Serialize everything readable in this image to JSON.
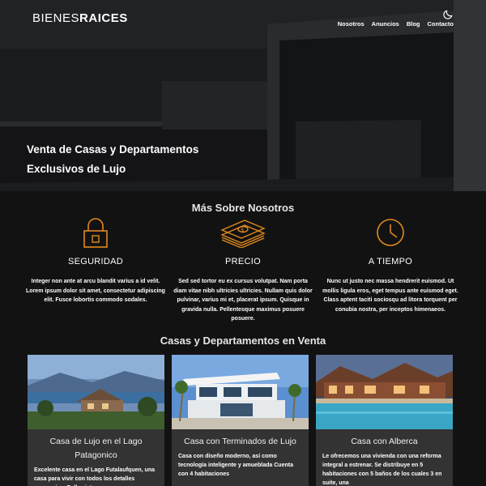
{
  "header": {
    "logo_light": "BIENES",
    "logo_bold": "RAICES",
    "nav": [
      "Nosotros",
      "Anuncios",
      "Blog",
      "Contacto"
    ],
    "theme_toggle_icon": "moon-icon"
  },
  "hero": {
    "title_line1": "Venta de Casas y Departamentos",
    "title_line2": "Exclusivos de Lujo"
  },
  "about": {
    "title": "Más Sobre Nosotros",
    "features": [
      {
        "icon": "lock-icon",
        "title": "SEGURIDAD",
        "text": "Integer non ante at arcu blandit varius a id velit. Lorem ipsum dolor sit amet, consectetur adipiscing elit. Fusce lobortis commodo sodales."
      },
      {
        "icon": "money-icon",
        "title": "PRECIO",
        "text": "Sed sed tortor eu ex cursus volutpat. Nam porta diam vitae nibh ultricies ultricies. Nullam quis dolor pulvinar, varius mi et, placerat ipsum. Quisque in gravida nulla. Pellentesque maximus posuere posuere."
      },
      {
        "icon": "clock-icon",
        "title": "A TIEMPO",
        "text": "Nunc ut justo nec massa hendrerit euismod. Ut mollis ligula eros, eget tempus ante euismod eget. Class aptent taciti sociosqu ad litora torquent per conubia nostra, per inceptos himenaeos."
      }
    ]
  },
  "listings": {
    "title": "Casas y Departamentos en Venta",
    "cards": [
      {
        "title": "Casa de Lujo en el Lago Patagonico",
        "text": "Excelente casa en el Lago Futalaufquen, una casa para vivir con todos los detalles necesarios. Bella vista"
      },
      {
        "title": "Casa con Terminados de Lujo",
        "text": "Casa con diseño moderno, así como tecnología inteligente y amueblada Cuenta con 4 habitaciones"
      },
      {
        "title": "Casa con Alberca",
        "text": "Le ofrecemos una vivienda con una reforma integral a estrenar. Se distribuye en 5 habitaciones con 5 baños de los cuales 3 en suite, una"
      }
    ]
  },
  "colors": {
    "accent": "#E08A1E",
    "background": "#121212",
    "card": "#333333"
  }
}
